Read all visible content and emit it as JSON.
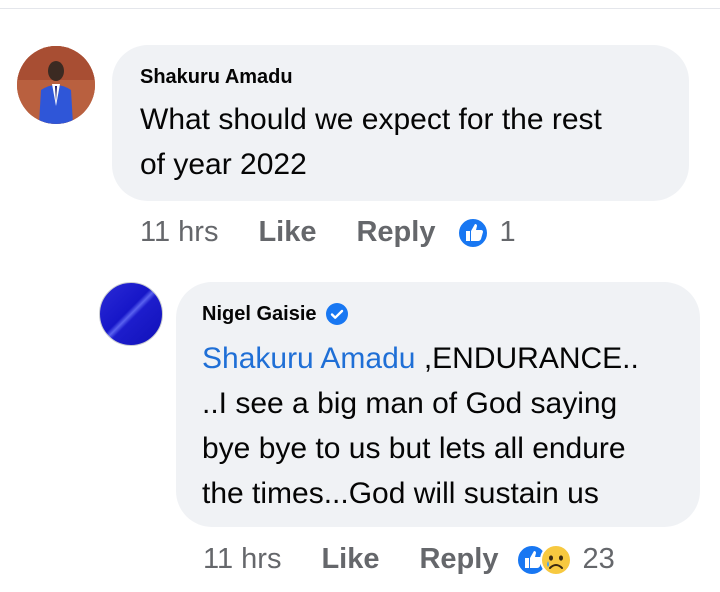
{
  "comment": {
    "author": "Shakuru Amadu",
    "text_line1": "What should we expect for the rest",
    "text_line2": "of year 2022",
    "time": "11 hrs",
    "like_label": "Like",
    "reply_label": "Reply",
    "reaction_count": "1",
    "reaction_icons": [
      "like-icon"
    ]
  },
  "reply": {
    "author": "Nigel Gaisie",
    "verified": true,
    "mention": "Shakuru Amadu",
    "line1_rest": " ,ENDURANCE..",
    "line2": "..I see a big man of God saying",
    "line3": "bye bye to us but lets all endure",
    "line4": "the times...God will sustain us",
    "time": "11 hrs",
    "like_label": "Like",
    "reply_label": "Reply",
    "reaction_count": "23",
    "reaction_icons": [
      "like-icon",
      "sad-icon"
    ]
  },
  "colors": {
    "bubble": "#f0f2f5",
    "mention": "#1f6fd6",
    "meta_text": "#65676b",
    "like_blue": "#1877f2"
  }
}
